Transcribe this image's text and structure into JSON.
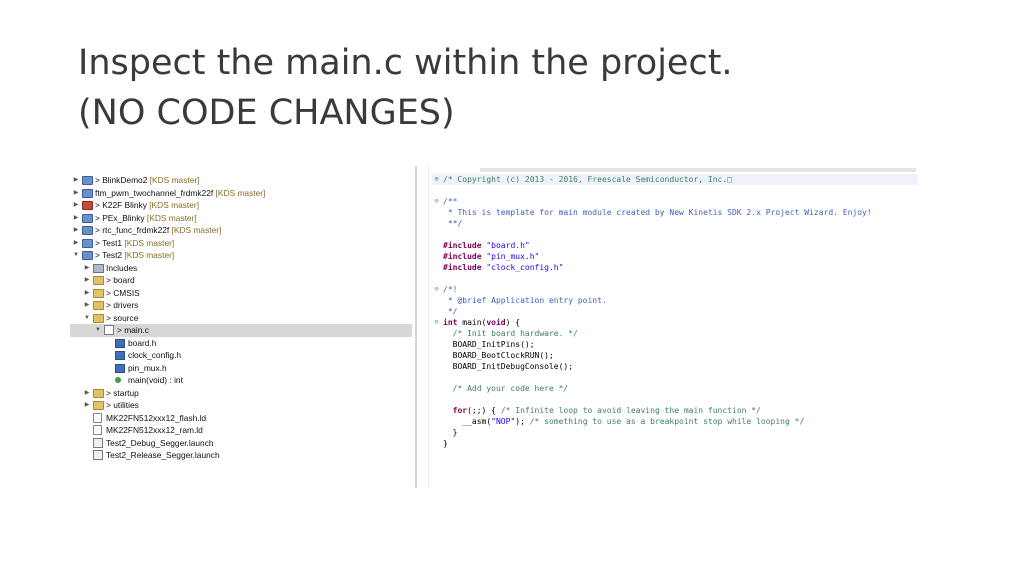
{
  "slide": {
    "title_line1": "Inspect the main.c within the project.",
    "title_line2": "(NO CODE CHANGES)"
  },
  "explorer": {
    "items": [
      {
        "label": "> BlinkDemo2",
        "tag": "[KDS master]",
        "icon": "project-icon",
        "twisty": "▶"
      },
      {
        "label": "ftm_pwm_twochannel_frdmk22f",
        "tag": "[KDS master]",
        "icon": "project-icon",
        "twisty": "▶"
      },
      {
        "label": "> K22F Blinky",
        "tag": "[KDS master]",
        "icon": "project-error-icon",
        "twisty": "▶"
      },
      {
        "label": "> PEx_Blinky",
        "tag": "[KDS master]",
        "icon": "project-icon",
        "twisty": "▶"
      },
      {
        "label": "> rtc_func_frdmk22f",
        "tag": "[KDS master]",
        "icon": "project-icon",
        "twisty": "▶"
      },
      {
        "label": "> Test1",
        "tag": "[KDS master]",
        "icon": "project-icon",
        "twisty": "▶"
      },
      {
        "label": "> Test2",
        "tag": "[KDS master]",
        "icon": "project-icon",
        "twisty": "▼"
      },
      {
        "label": "Includes",
        "icon": "includes-icon",
        "twisty": "▶"
      },
      {
        "label": "> board",
        "icon": "folder-icon",
        "twisty": "▶"
      },
      {
        "label": "> CMSIS",
        "icon": "folder-icon",
        "twisty": "▶"
      },
      {
        "label": "> drivers",
        "icon": "folder-icon",
        "twisty": "▶"
      },
      {
        "label": "> source",
        "icon": "folder-icon",
        "twisty": "▼"
      },
      {
        "label": "> main.c",
        "icon": "c-file-icon",
        "twisty": "▼"
      },
      {
        "label": "board.h",
        "icon": "header-file-icon",
        "twisty": ""
      },
      {
        "label": "clock_config.h",
        "icon": "header-file-icon",
        "twisty": ""
      },
      {
        "label": "pin_mux.h",
        "icon": "header-file-icon",
        "twisty": ""
      },
      {
        "label": "main(void) : int",
        "icon": "function-icon",
        "twisty": ""
      },
      {
        "label": "> startup",
        "icon": "folder-icon",
        "twisty": "▶"
      },
      {
        "label": "> utilities",
        "icon": "folder-icon",
        "twisty": "▶"
      },
      {
        "label": "MK22FN512xxx12_flash.ld",
        "icon": "linker-file-icon",
        "twisty": ""
      },
      {
        "label": "MK22FN512xxx12_ram.ld",
        "icon": "linker-file-icon",
        "twisty": ""
      },
      {
        "label": "Test2_Debug_Segger.launch",
        "icon": "launch-file-icon",
        "twisty": ""
      },
      {
        "label": "Test2_Release_Segger.launch",
        "icon": "launch-file-icon",
        "twisty": ""
      }
    ]
  },
  "editor": {
    "lines": [
      {
        "fold": "⊕",
        "parts": [
          {
            "t": "/* Copyright (c) 2013 - 2016, Freescale Semiconductor, Inc.□",
            "c": "comment"
          }
        ]
      },
      {
        "fold": "",
        "parts": []
      },
      {
        "fold": "⊖",
        "parts": [
          {
            "t": "/**",
            "c": "doc"
          }
        ]
      },
      {
        "fold": "",
        "parts": [
          {
            "t": " * This is template for main module created by New Kinetis SDK 2.x Project Wizard. Enjoy!",
            "c": "doc"
          }
        ]
      },
      {
        "fold": "",
        "parts": [
          {
            "t": " **/",
            "c": "doc"
          }
        ]
      },
      {
        "fold": "",
        "parts": []
      },
      {
        "fold": "",
        "parts": [
          {
            "t": "#include ",
            "c": "pp"
          },
          {
            "t": "\"board.h\"",
            "c": "str"
          }
        ]
      },
      {
        "fold": "",
        "parts": [
          {
            "t": "#include ",
            "c": "pp"
          },
          {
            "t": "\"pin_mux.h\"",
            "c": "str"
          }
        ]
      },
      {
        "fold": "",
        "parts": [
          {
            "t": "#include ",
            "c": "pp"
          },
          {
            "t": "\"clock_config.h\"",
            "c": "str"
          }
        ]
      },
      {
        "fold": "",
        "parts": []
      },
      {
        "fold": "⊖",
        "parts": [
          {
            "t": "/*!",
            "c": "doc"
          }
        ]
      },
      {
        "fold": "",
        "parts": [
          {
            "t": " * @brief Application entry point.",
            "c": "doc"
          }
        ]
      },
      {
        "fold": "",
        "parts": [
          {
            "t": " */",
            "c": "doc"
          }
        ]
      },
      {
        "fold": "⊖",
        "parts": [
          {
            "t": "int ",
            "c": "kw"
          },
          {
            "t": "main(",
            "c": "plain"
          },
          {
            "t": "void",
            "c": "kw"
          },
          {
            "t": ") {",
            "c": "plain"
          }
        ]
      },
      {
        "fold": "",
        "parts": [
          {
            "t": "  /* Init board hardware. */",
            "c": "comment"
          }
        ]
      },
      {
        "fold": "",
        "parts": [
          {
            "t": "  BOARD_InitPins();",
            "c": "plain"
          }
        ]
      },
      {
        "fold": "",
        "parts": [
          {
            "t": "  BOARD_BootClockRUN();",
            "c": "plain"
          }
        ]
      },
      {
        "fold": "",
        "parts": [
          {
            "t": "  BOARD_InitDebugConsole();",
            "c": "plain"
          }
        ]
      },
      {
        "fold": "",
        "parts": []
      },
      {
        "fold": "",
        "parts": [
          {
            "t": "  /* Add your code here */",
            "c": "comment"
          }
        ]
      },
      {
        "fold": "",
        "parts": []
      },
      {
        "fold": "",
        "parts": [
          {
            "t": "  ",
            "c": "plain"
          },
          {
            "t": "for",
            "c": "kw"
          },
          {
            "t": "(;;) { ",
            "c": "plain"
          },
          {
            "t": "/* Infinite loop to avoid leaving the main function */",
            "c": "comment"
          }
        ]
      },
      {
        "fold": "",
        "parts": [
          {
            "t": "    __asm(",
            "c": "plain"
          },
          {
            "t": "\"NOP\"",
            "c": "str"
          },
          {
            "t": "); ",
            "c": "plain"
          },
          {
            "t": "/* something to use as a breakpoint stop while looping */",
            "c": "comment"
          }
        ]
      },
      {
        "fold": "",
        "parts": [
          {
            "t": "  }",
            "c": "plain"
          }
        ]
      },
      {
        "fold": "",
        "parts": [
          {
            "t": "}",
            "c": "plain"
          }
        ]
      }
    ]
  },
  "colors": {
    "selection": "#d7d7d7",
    "keyword": "#7f0055",
    "comment": "#3f7f5f",
    "doc_comment": "#3f5fbf",
    "string": "#2a00ff"
  }
}
